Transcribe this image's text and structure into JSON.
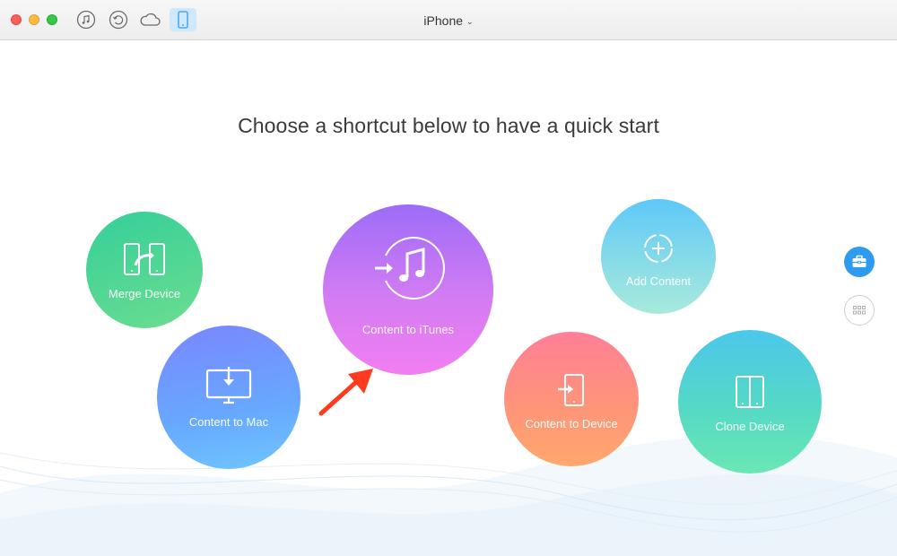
{
  "window": {
    "toolbar": {
      "buttons": [
        {
          "id": "music",
          "icon": "music-note-icon"
        },
        {
          "id": "backup",
          "icon": "history-icon"
        },
        {
          "id": "icloud",
          "icon": "cloud-icon"
        },
        {
          "id": "device",
          "icon": "iphone-icon",
          "active": true
        }
      ],
      "device_selector": {
        "label": "iPhone",
        "icon": "chevron-down-icon"
      }
    }
  },
  "main": {
    "headline": "Choose a shortcut below to have a quick start",
    "shortcuts": [
      {
        "id": "merge-device",
        "label": "Merge Device",
        "icon": "merge-devices-icon",
        "color": "#4fd694"
      },
      {
        "id": "content-to-mac",
        "label": "Content to Mac",
        "icon": "monitor-download-icon",
        "color": "#6fa6ff"
      },
      {
        "id": "content-to-itunes",
        "label": "Content to iTunes",
        "icon": "itunes-transfer-icon",
        "color": "#c675f4"
      },
      {
        "id": "add-content",
        "label": "Add Content",
        "icon": "add-circle-icon",
        "color": "#7fd7ea"
      },
      {
        "id": "content-to-device",
        "label": "Content to Device",
        "icon": "phone-import-icon",
        "color": "#ff8c84"
      },
      {
        "id": "clone-device",
        "label": "Clone Device",
        "icon": "clone-device-icon",
        "color": "#55d6c8"
      }
    ]
  },
  "sidebar": {
    "buttons": [
      {
        "id": "toolkit",
        "icon": "toolbox-icon",
        "active": true,
        "color": "#2f9bef"
      },
      {
        "id": "more",
        "icon": "grid-icon",
        "active": false
      }
    ]
  },
  "annotation": {
    "icon": "red-arrow-icon",
    "color": "#ff3b1f"
  }
}
